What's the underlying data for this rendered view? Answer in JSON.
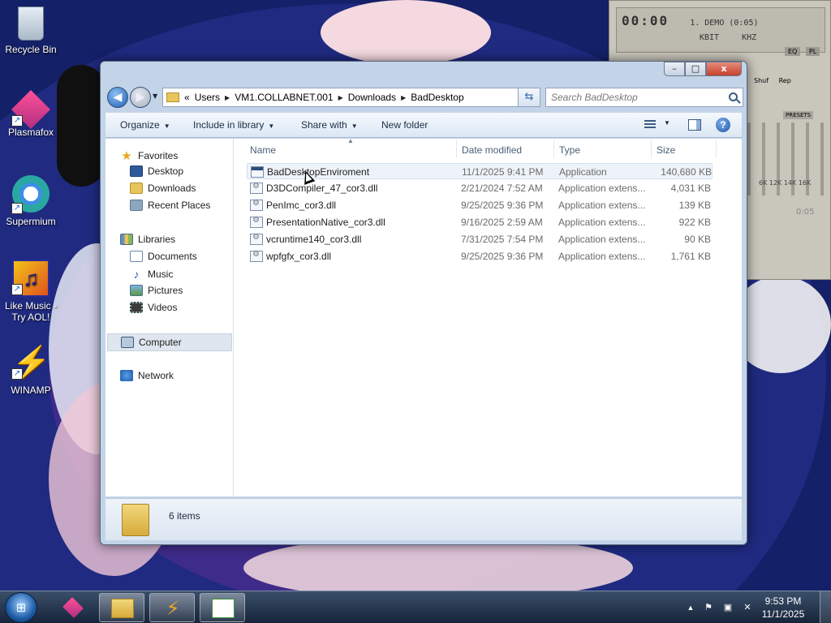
{
  "desktop": {
    "icons": [
      {
        "label": "Recycle Bin",
        "icon": "recycle-bin-icon"
      },
      {
        "label": "Plasmafox",
        "icon": "plasmafox-icon"
      },
      {
        "label": "Supermium",
        "icon": "supermium-icon"
      },
      {
        "label": "Like Music - Try AOL!",
        "icon": "music-icon"
      },
      {
        "label": "WINAMP",
        "icon": "winamp-icon"
      }
    ]
  },
  "winamp": {
    "time": "00:00",
    "track": "1. DEMO (0:05)",
    "kbit": "KBIT",
    "khz": "KHZ",
    "eq_label": "EQ",
    "pl_label": "PL",
    "shuf": "Shuf",
    "rep": "Rep",
    "presets": "PRESETS",
    "eq_freqs": "6K  12K  14K  16K",
    "pl_time": "0:05"
  },
  "window": {
    "caption": {
      "minimize": "–",
      "maximize": "□",
      "close": "x"
    },
    "address": {
      "overflow": "«",
      "crumbs": [
        "Users",
        "VM1.COLLABNET.001",
        "Downloads",
        "BadDesktop"
      ]
    },
    "search_placeholder": "Search BadDesktop",
    "toolbar": {
      "organize": "Organize",
      "include": "Include in library",
      "share": "Share with",
      "new_folder": "New folder"
    },
    "nav": {
      "favorites": "Favorites",
      "desktop": "Desktop",
      "downloads": "Downloads",
      "recent": "Recent Places",
      "libraries": "Libraries",
      "documents": "Documents",
      "music": "Music",
      "pictures": "Pictures",
      "videos": "Videos",
      "computer": "Computer",
      "network": "Network"
    },
    "columns": {
      "name": "Name",
      "date": "Date modified",
      "type": "Type",
      "size": "Size"
    },
    "files": [
      {
        "name": "BadDesktopEnviroment",
        "date": "11/1/2025 9:41 PM",
        "type": "Application",
        "size": "140,680 KB"
      },
      {
        "name": "D3DCompiler_47_cor3.dll",
        "date": "2/21/2024 7:52 AM",
        "type": "Application extens...",
        "size": "4,031 KB"
      },
      {
        "name": "PenImc_cor3.dll",
        "date": "9/25/2025 9:36 PM",
        "type": "Application extens...",
        "size": "139 KB"
      },
      {
        "name": "PresentationNative_cor3.dll",
        "date": "9/16/2025 2:59 AM",
        "type": "Application extens...",
        "size": "922 KB"
      },
      {
        "name": "vcruntime140_cor3.dll",
        "date": "7/31/2025 7:54 PM",
        "type": "Application extens...",
        "size": "90 KB"
      },
      {
        "name": "wpfgfx_cor3.dll",
        "date": "9/25/2025 9:36 PM",
        "type": "Application extens...",
        "size": "1,761 KB"
      }
    ],
    "details": {
      "count": "6 items"
    }
  },
  "taskbar": {
    "time": "9:53 PM",
    "date": "11/1/2025",
    "tray_up": "▲"
  }
}
